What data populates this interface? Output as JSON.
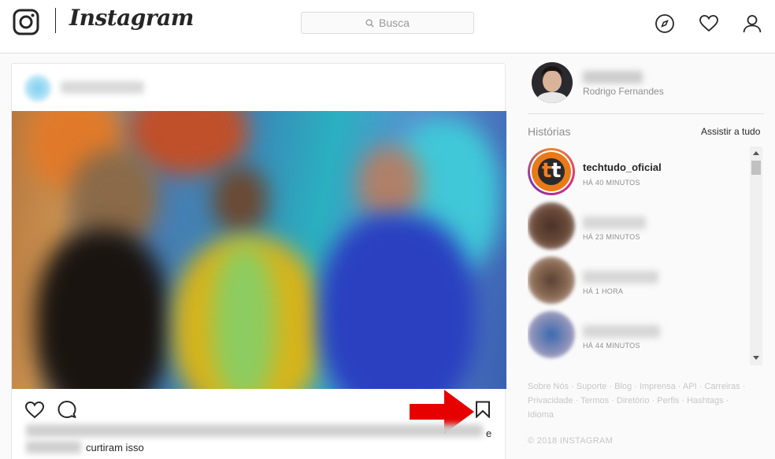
{
  "header": {
    "brand": "Instagram",
    "search_placeholder": "Busca",
    "icons": [
      "instagram-logo-icon",
      "search-icon",
      "compass-icon",
      "heart-icon",
      "profile-icon"
    ]
  },
  "post": {
    "caption_end": "e",
    "liked_text": "curtiram isso",
    "icons": [
      "heart-icon",
      "comment-icon",
      "bookmark-icon"
    ],
    "highlight_arrow_color": "#e60000"
  },
  "sidebar": {
    "profile_name": "Rodrigo Fernandes",
    "stories_title": "Histórias",
    "watch_all": "Assistir a tudo",
    "stories": [
      {
        "username": "techtudo_oficial",
        "time": "HÁ 40 MINUTOS"
      },
      {
        "username": "",
        "time": "HÁ 23 MINUTOS"
      },
      {
        "username": "",
        "time": "HÁ 1 HORA"
      },
      {
        "username": "",
        "time": "HÁ 44 MINUTOS"
      }
    ],
    "footer_links": [
      "Sobre Nós",
      "Suporte",
      "Blog",
      "Imprensa",
      "API",
      "Carreiras",
      "Privacidade",
      "Termos",
      "Diretório",
      "Perfis",
      "Hashtags",
      "Idioma"
    ],
    "copyright": "© 2018 INSTAGRAM"
  },
  "colors": {
    "background": "#fafafa",
    "border": "#dbdbdb",
    "text": "#262626",
    "muted": "#8e8e8e",
    "arrow": "#e60000"
  }
}
